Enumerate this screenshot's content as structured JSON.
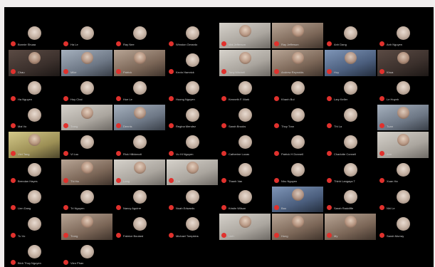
{
  "participants": [
    {
      "name": "Bonnie Shuaa",
      "video": false
    },
    {
      "name": "Ha Le",
      "video": false
    },
    {
      "name": "Ray Nee",
      "video": false
    },
    {
      "name": "Winston Gerardo",
      "video": false
    },
    {
      "name": "Mai Jefferson",
      "video": true,
      "tone": "light"
    },
    {
      "name": "Ray Jefferson",
      "video": true,
      "tone": "warm"
    },
    {
      "name": "Anh Dang",
      "video": false
    },
    {
      "name": "Anh Nguyen",
      "video": false
    },
    {
      "name": "Chau",
      "video": true,
      "tone": "dark"
    },
    {
      "name": "Mike",
      "video": true,
      "tone": "cool"
    },
    {
      "name": "Patrick",
      "video": true,
      "tone": "warm"
    },
    {
      "name": "Kevin Hamrick",
      "video": false
    },
    {
      "name": "Tony Mitchell",
      "video": true,
      "tone": "light"
    },
    {
      "name": "Andrew Reynolds",
      "video": true,
      "tone": "warm"
    },
    {
      "name": "Huy",
      "video": true,
      "tone": "blue"
    },
    {
      "name": "Khoa",
      "video": true,
      "tone": "dark"
    },
    {
      "name": "Ha Nguyen",
      "video": false
    },
    {
      "name": "Huy Chai",
      "video": false
    },
    {
      "name": "Hue Le",
      "video": false
    },
    {
      "name": "Huong Nguyen",
      "video": false
    },
    {
      "name": "Kenneth F. Mark",
      "video": false
    },
    {
      "name": "Khanh Bui",
      "video": false
    },
    {
      "name": "Lary Keller",
      "video": false
    },
    {
      "name": "Le Huynh",
      "video": false
    },
    {
      "name": "Mai Vo",
      "video": false
    },
    {
      "name": "Trang",
      "video": true,
      "tone": "light"
    },
    {
      "name": "Dennis",
      "video": true,
      "tone": "cool"
    },
    {
      "name": "Regina Mendez",
      "video": false
    },
    {
      "name": "Sarah Brooks",
      "video": false
    },
    {
      "name": "Thuy Tran",
      "video": false
    },
    {
      "name": "Thi La",
      "video": false
    },
    {
      "name": "Tuan",
      "video": true,
      "tone": "cool"
    },
    {
      "name": "Viet Tang",
      "video": true,
      "tone": "yellow"
    },
    {
      "name": "Vi Luu",
      "video": false
    },
    {
      "name": "Rick Hilldorodt",
      "video": false
    },
    {
      "name": "Vu Hi Nguyen",
      "video": false
    },
    {
      "name": "Catherine Lucas",
      "video": false
    },
    {
      "name": "Patrick H Donnell",
      "video": false
    },
    {
      "name": "Charlotte Connell",
      "video": false
    },
    {
      "name": "Ann",
      "video": true,
      "tone": "light"
    },
    {
      "name": "Brendan Hayes",
      "video": false
    },
    {
      "name": "Thi Ha",
      "video": true,
      "tone": "warm"
    },
    {
      "name": "Long",
      "video": true,
      "tone": "light"
    },
    {
      "name": "Chi",
      "video": true,
      "tone": "light"
    },
    {
      "name": "Thanh Van",
      "video": false
    },
    {
      "name": "Nhu Nguyen",
      "video": false
    },
    {
      "name": "Thinh Langaya T",
      "video": false
    },
    {
      "name": "Xuan Ha",
      "video": false
    },
    {
      "name": "Lien Dang",
      "video": false
    },
    {
      "name": "Tri Nguyen",
      "video": false
    },
    {
      "name": "Nancy Aguirre",
      "video": false
    },
    {
      "name": "Noah Edwards",
      "video": false
    },
    {
      "name": "Kristin Wilson",
      "video": false
    },
    {
      "name": "Bao",
      "video": true,
      "tone": "blue"
    },
    {
      "name": "Sarah Radcliffe",
      "video": false
    },
    {
      "name": "Nhi Le",
      "video": false
    },
    {
      "name": "Tu Vo",
      "video": false
    },
    {
      "name": "Trong",
      "video": true,
      "tone": "warm"
    },
    {
      "name": "Fabrice Boulard",
      "video": false
    },
    {
      "name": "Michael Tompkins",
      "video": false
    },
    {
      "name": "Linh",
      "video": true,
      "tone": "light"
    },
    {
      "name": "Hung",
      "video": true,
      "tone": "warm"
    },
    {
      "name": "My",
      "video": true,
      "tone": "warm"
    },
    {
      "name": "Sarah Murray",
      "video": false
    },
    {
      "name": "Binh Thuy Nguyen",
      "video": false
    },
    {
      "name": "Vien Phan",
      "video": false
    }
  ]
}
